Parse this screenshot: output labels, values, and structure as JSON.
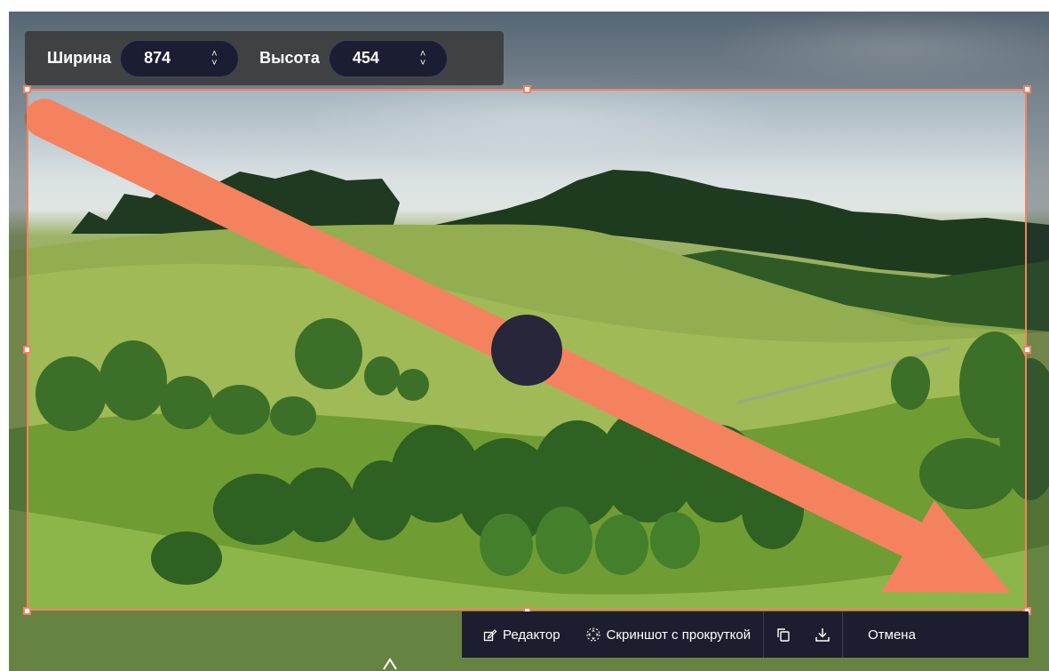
{
  "dimensions": {
    "width_label": "Ширина",
    "width_value": "874",
    "height_label": "Высота",
    "height_value": "454"
  },
  "actions": {
    "editor_label": "Редактор",
    "scroll_label": "Скриншот с прокруткой",
    "cancel_label": "Отмена"
  },
  "colors": {
    "selection": "#f5825e",
    "arrow": "#f5825e",
    "panel": "#1c1e2f",
    "stepper": "#1b1d33"
  },
  "icons": {
    "editor": "edit-icon",
    "scroll": "scroll-capture-icon",
    "copy": "copy-icon",
    "download": "download-icon"
  }
}
